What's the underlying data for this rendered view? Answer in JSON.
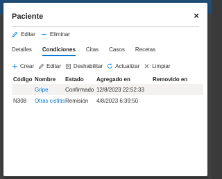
{
  "dialog": {
    "title": "Paciente",
    "close_glyph": "×"
  },
  "commands": {
    "edit_label": "Editar",
    "delete_label": "Eliminar"
  },
  "tabs": [
    {
      "label": "Detalles",
      "active": false
    },
    {
      "label": "Condiciones",
      "active": true
    },
    {
      "label": "Citas",
      "active": false
    },
    {
      "label": "Casos",
      "active": false
    },
    {
      "label": "Recetas",
      "active": false
    }
  ],
  "toolbar": {
    "create_label": "Crear",
    "edit_label": "Editar",
    "disable_label": "Deshabilitar",
    "refresh_label": "Actualizar",
    "clear_label": "Limpiar"
  },
  "table": {
    "headers": [
      "Código",
      "Nombre",
      "Estado",
      "Agregado en",
      "Removido en"
    ],
    "rows": [
      {
        "code": "",
        "name": "Gripe",
        "status": "Confirmado",
        "added": "12/8/2023 22:52:33",
        "removed": ""
      },
      {
        "code": "N308",
        "name": "Otras cistitis",
        "status": "Remisión",
        "added": "4/8/2023 6:39:50",
        "removed": ""
      }
    ]
  },
  "colors": {
    "accent": "#0078d4",
    "header_band": "#1f4e79"
  },
  "icons": {
    "edit": "pencil-icon",
    "delete": "minus-icon",
    "create": "plus-icon",
    "disable": "disable-box-icon",
    "refresh": "refresh-icon",
    "clear": "x-icon",
    "close": "close-icon"
  }
}
